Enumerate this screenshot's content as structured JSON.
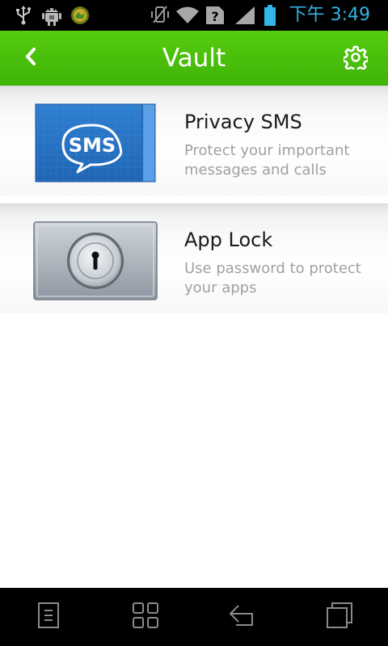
{
  "status_bar": {
    "clock": "下午 3:49",
    "icons": [
      "usb-icon",
      "android-debug-icon",
      "app-notification-icon",
      "vibrate-icon",
      "wifi-icon",
      "no-sim-icon",
      "signal-icon",
      "battery-icon"
    ],
    "clock_color": "#33b5e5"
  },
  "action_bar": {
    "title": "Vault",
    "color": "#4cc10b",
    "back_icon": "chevron-left-icon",
    "settings_icon": "gear-icon"
  },
  "features": [
    {
      "title": "Privacy SMS",
      "description": "Protect your important messages and calls",
      "icon": "sms-icon",
      "icon_text": "SMS"
    },
    {
      "title": "App Lock",
      "description": "Use password to protect your apps",
      "icon": "keyhole-lock-icon"
    }
  ],
  "nav_bar": {
    "buttons": [
      "menu-icon",
      "apps-grid-icon",
      "back-icon",
      "recent-apps-icon"
    ]
  }
}
